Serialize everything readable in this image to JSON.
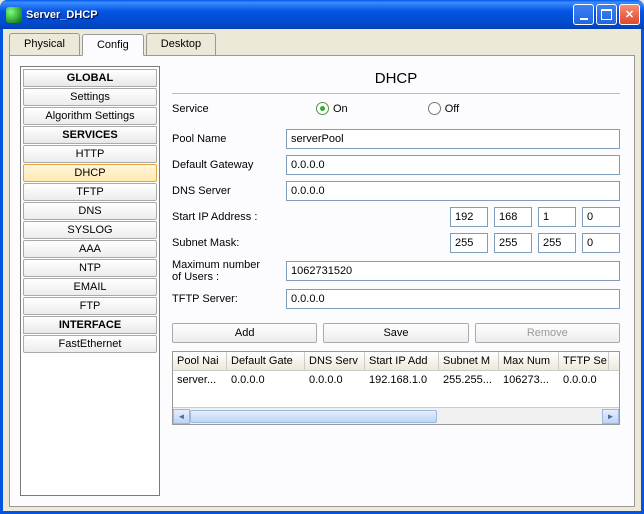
{
  "window": {
    "title": "Server_DHCP"
  },
  "tabs": {
    "physical": "Physical",
    "config": "Config",
    "desktop": "Desktop",
    "active": "config"
  },
  "sidebar": {
    "global_header": "GLOBAL",
    "settings": "Settings",
    "algorithm": "Algorithm Settings",
    "services_header": "SERVICES",
    "http": "HTTP",
    "dhcp": "DHCP",
    "tftp": "TFTP",
    "dns": "DNS",
    "syslog": "SYSLOG",
    "aaa": "AAA",
    "ntp": "NTP",
    "email": "EMAIL",
    "ftp": "FTP",
    "interface_header": "INTERFACE",
    "fastethernet": "FastEthernet"
  },
  "panel": {
    "title": "DHCP",
    "service_label": "Service",
    "on_label": "On",
    "off_label": "Off",
    "pool_name_label": "Pool Name",
    "pool_name": "serverPool",
    "gateway_label": "Default Gateway",
    "gateway": "0.0.0.0",
    "dns_label": "DNS Server",
    "dns": "0.0.0.0",
    "start_ip_label": "Start IP Address :",
    "start_ip": [
      "192",
      "168",
      "1",
      "0"
    ],
    "subnet_label": "Subnet Mask:",
    "subnet": [
      "255",
      "255",
      "255",
      "0"
    ],
    "max_users_label": "Maximum number\n of Users :",
    "max_users": "1062731520",
    "tftp_label": "TFTP Server:",
    "tftp": "0.0.0.0",
    "add_btn": "Add",
    "save_btn": "Save",
    "remove_btn": "Remove"
  },
  "table": {
    "headers": [
      "Pool Nai",
      "Default Gate",
      "DNS Serv",
      "Start IP Add",
      "Subnet M",
      "Max Num",
      "TFTP Se"
    ],
    "row": [
      "server...",
      "0.0.0.0",
      "0.0.0.0",
      "192.168.1.0",
      "255.255...",
      "106273...",
      "0.0.0.0"
    ]
  }
}
